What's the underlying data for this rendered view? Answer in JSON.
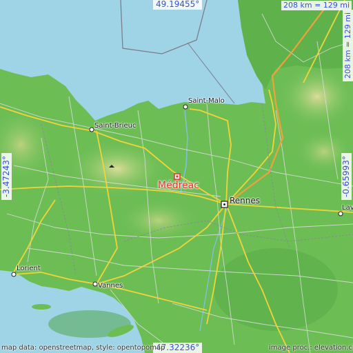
{
  "colors": {
    "sea": "#9fd3e6",
    "land_low": "#4fae45",
    "land_mid": "#74c35a",
    "land_high": "#c7d98a",
    "road_major": "#f2d43a",
    "road_motorway": "#f0a23a",
    "road_minor": "#e8e8e8",
    "marker": "#e0342a",
    "coord_text": "#3b4fd6"
  },
  "cities": [
    {
      "name": "Saint-Malo"
    },
    {
      "name": "Saint-Brieuc"
    },
    {
      "name": "Rennes"
    },
    {
      "name": "Lorient"
    },
    {
      "name": "Vannes"
    },
    {
      "name": "Lav"
    }
  ],
  "main_place": {
    "name": "Médréac"
  },
  "coordinates": {
    "top_lat": "49.19455°",
    "bottom_lat": "47.32236°",
    "left_lon": "-3.47243°",
    "right_lon": "-0.65993°"
  },
  "scale": {
    "top": "208 km = 129 mi",
    "right": "208 km = 129 mi"
  },
  "attribution": {
    "left": "map data: openstreetmap, style: opentopomap",
    "right": "image proc.: elevation.city"
  }
}
